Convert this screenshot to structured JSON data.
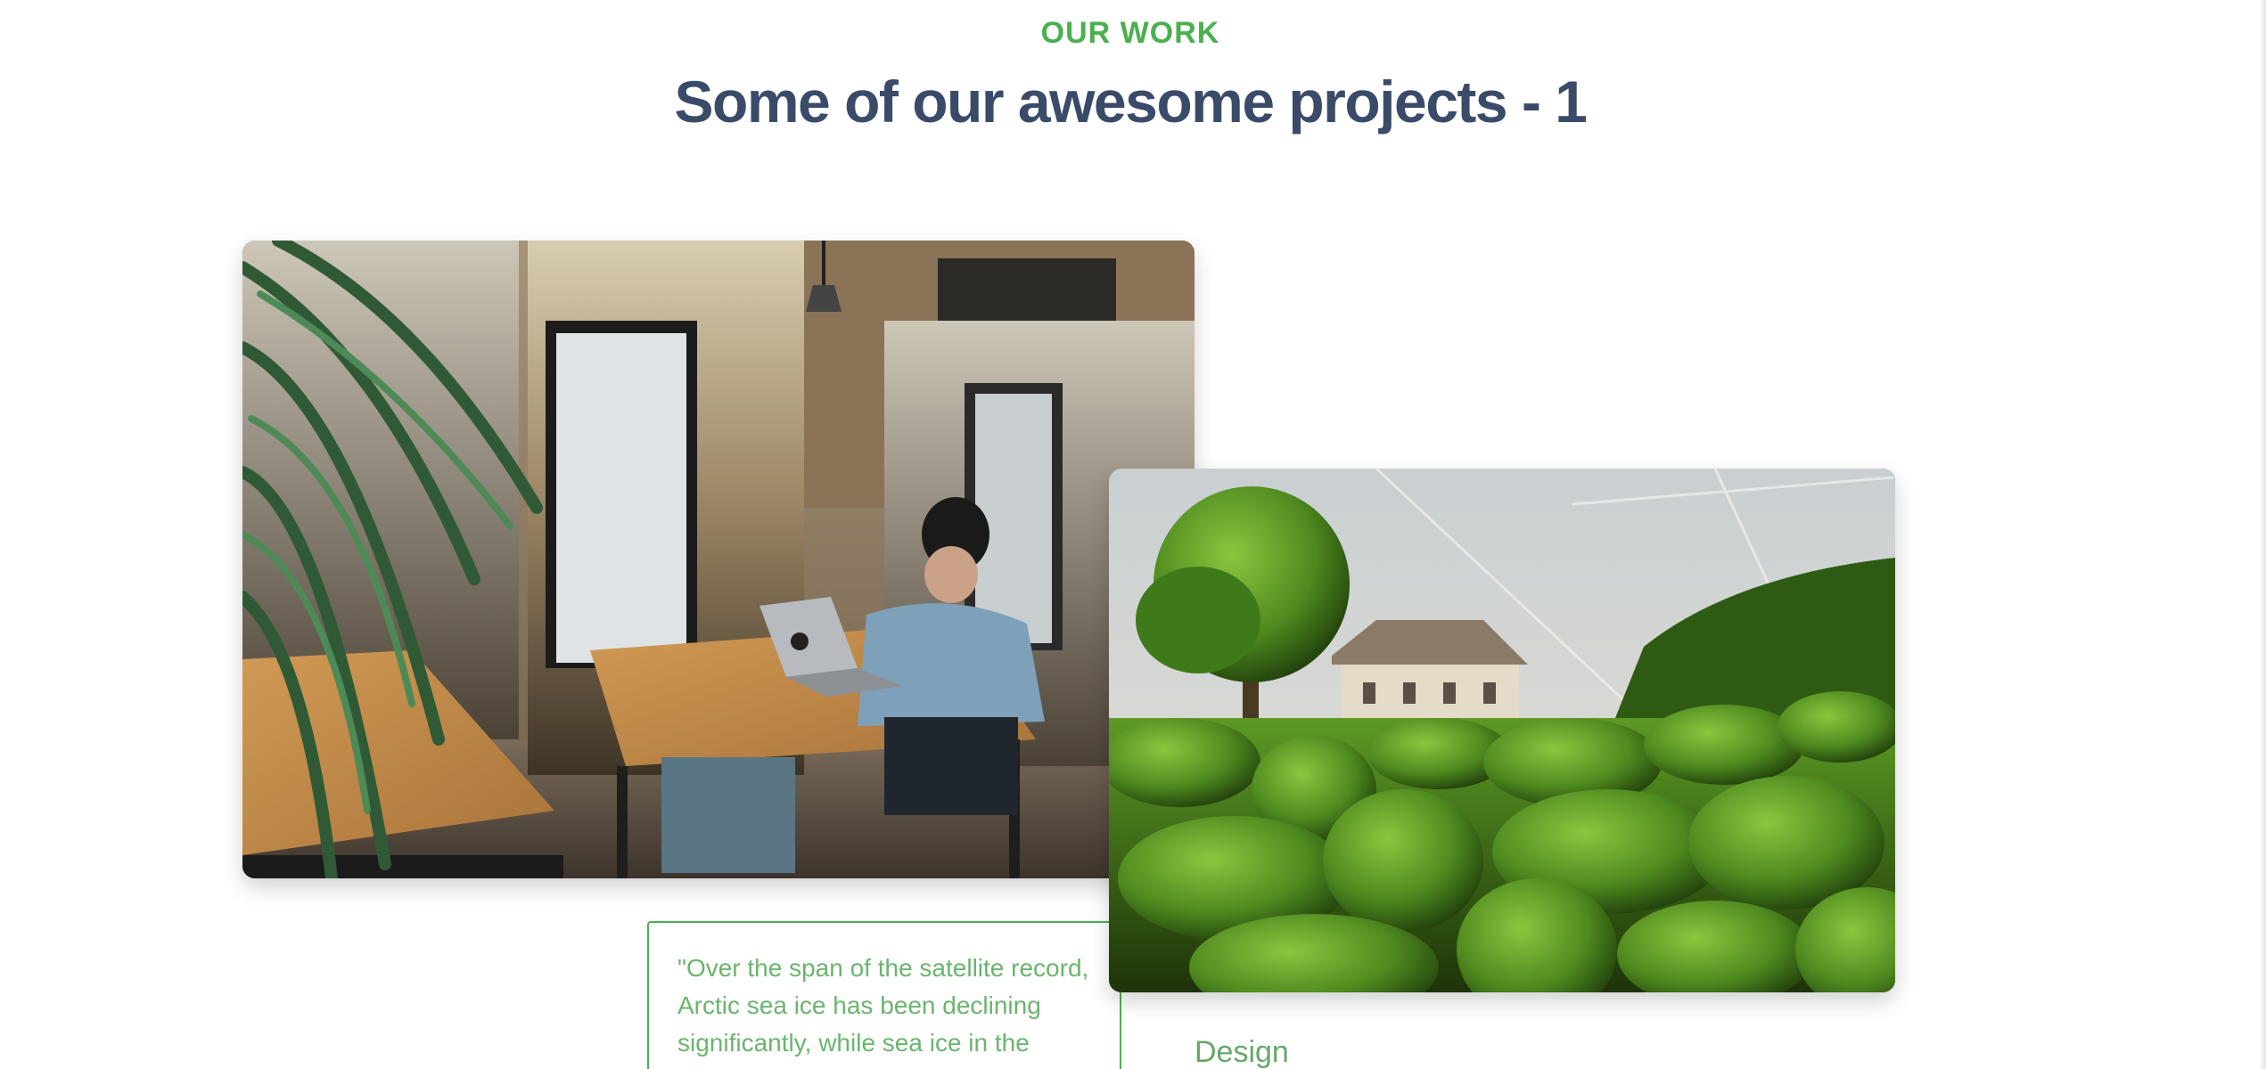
{
  "section": {
    "eyebrow": "OUR WORK",
    "title": "Some of our awesome projects - 1"
  },
  "projects": [
    {
      "image_subject": "person working on laptop at wooden desk in office booth with plant"
    },
    {
      "image_subject": "manor house behind topiary garden of sculpted hedges"
    }
  ],
  "testimonial": {
    "text": "\"Over the span of the satellite record, Arctic sea ice has been declining significantly, while sea ice in the"
  },
  "project_label": "Design",
  "colors": {
    "accent": "#4caf50",
    "heading": "#3a4b6a",
    "quote_text": "#6ab56e"
  }
}
